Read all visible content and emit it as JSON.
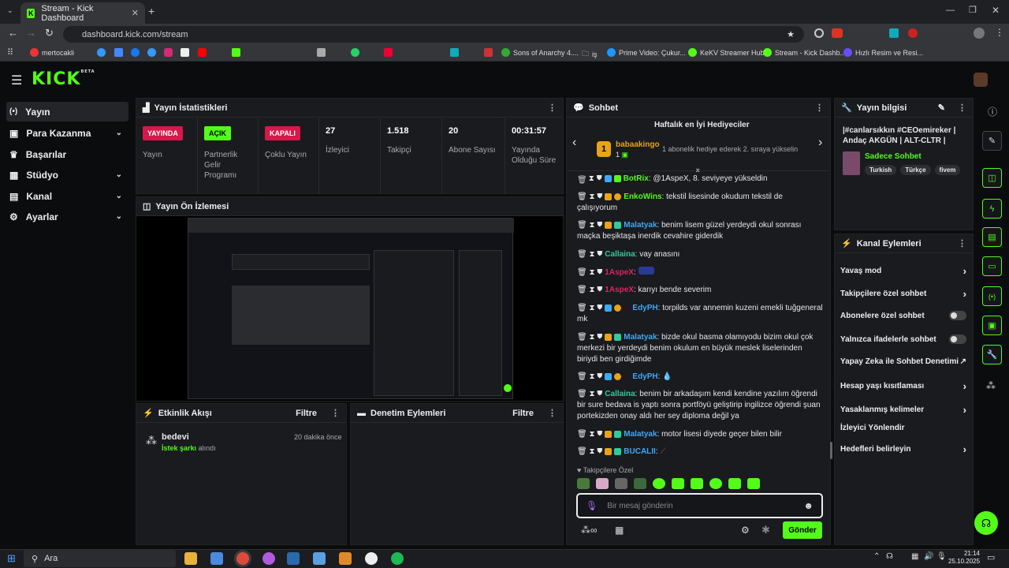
{
  "browser": {
    "tab_title": "Stream - Kick Dashboard",
    "url": "dashboard.kick.com/stream",
    "bookmarks": [
      "mertocakli",
      "Sons of Anarchy 4....",
      "iş",
      "Prime Video: Çukur...",
      "KeKV Streamer Hub",
      "Stream - Kick Dashb...",
      "Hızlı Resim ve Resi..."
    ]
  },
  "header": {
    "logo": "KICK",
    "beta": "BETA"
  },
  "sidebar": {
    "items": [
      {
        "label": "Yayın"
      },
      {
        "label": "Para Kazanma"
      },
      {
        "label": "Başarılar"
      },
      {
        "label": "Stüdyo"
      },
      {
        "label": "Kanal"
      },
      {
        "label": "Ayarlar"
      }
    ]
  },
  "stats": {
    "title": "Yayın İstatistikleri",
    "items": [
      {
        "value": "YAYINDA",
        "label": "Yayın",
        "color": "#d8184a"
      },
      {
        "value": "AÇIK",
        "label": "Partnerlik Gelir Programı",
        "color": "#53fc18"
      },
      {
        "value": "KAPALI",
        "label": "Çoklu Yayın",
        "color": "#d8184a"
      },
      {
        "value": "27",
        "label": "İzleyici"
      },
      {
        "value": "1.518",
        "label": "Takipçi"
      },
      {
        "value": "20",
        "label": "Abone Sayısı"
      },
      {
        "value": "00:31:57",
        "label": "Yayında Olduğu Süre"
      }
    ]
  },
  "preview": {
    "title": "Yayın Ön İzlemesi"
  },
  "activity": {
    "title": "Etkinlik Akışı",
    "filter": "Filtre",
    "item": {
      "user": "bedevi",
      "action": "İstek şarkı",
      "suffix": "alındı",
      "time": "20 dakika önce"
    }
  },
  "moderation": {
    "title": "Denetim Eylemleri",
    "filter": "Filtre"
  },
  "chat": {
    "title": "Sohbet",
    "gifters_title": "Haftalık en İyi Hediyeciler",
    "gifter_name": "babaakingo",
    "gifter_count": "1",
    "gifter_rank": "1",
    "gifter_note": "1 abonelik hediye ederek 2. sıraya yükselin",
    "messages": [
      {
        "user": "BotRix",
        "color": "#53fc18",
        "text": ": @1AspeX, 8. seviyeye yükseldin"
      },
      {
        "user": "EnkoWins",
        "color": "#53fc18",
        "text": ": tekstil lisesinde okudum tekstil de çalışıyorum"
      },
      {
        "user": "Malatyak",
        "color": "#3fa9f5",
        "text": ": benim lisem güzel yerdeydi okul sonrası maçka beşiktaşa inerdik cevahire giderdik"
      },
      {
        "user": "Callaina",
        "color": "#2ecc9a",
        "text": ": vay anasını"
      },
      {
        "user": "1AspeX",
        "color": "#e0245e",
        "text": ":"
      },
      {
        "user": "1AspeX",
        "color": "#e0245e",
        "text": ": karıyı bende severim"
      },
      {
        "user": "EdyPH",
        "color": "#3fa9f5",
        "text": ": torpilds var annemin kuzeni emekli tuğgeneral mk"
      },
      {
        "user": "Malatyak",
        "color": "#3fa9f5",
        "text": ": bizde okul basma olamıyodu bizim okul çok merkezi bir yerdeydi benim okulum en büyük meslek liselerinden biriydi ben girdiğimde"
      },
      {
        "user": "EdyPH",
        "color": "#3fa9f5",
        "text": ":"
      },
      {
        "user": "Callaina",
        "color": "#2ecc9a",
        "text": ": benim bir arkadaşım kendi kendine yazılım öğrendi bir sure bedava is yaptı sonra portföyü geliştirip ingilizce öğrendi şuan portekizden onay aldı her sey diploma değil ya"
      },
      {
        "user": "Malatyak",
        "color": "#3fa9f5",
        "text": ": motor lisesi diyede geçer bilen bilir"
      },
      {
        "user": "BUCALII",
        "color": "#3fa9f5",
        "text": ":"
      }
    ],
    "followers_only": "Takipçilere Özel",
    "placeholder": "Bir mesaj gönderin",
    "send": "Gönder"
  },
  "info": {
    "title": "Yayın bilgisi",
    "stream_title": "|#canlarsıkkın #CEOemireker | Andaç AKGÜN | ALT-CLTR | KEK...",
    "chat_mode": "Sadece Sohbet",
    "tags": [
      "Turkish",
      "Türkçe",
      "fivem"
    ]
  },
  "channel_actions": {
    "title": "Kanal Eylemleri",
    "items": [
      {
        "label": "Yavaş mod",
        "type": "chev"
      },
      {
        "label": "Takipçilere özel sohbet",
        "type": "chev"
      },
      {
        "label": "Abonelere özel sohbet",
        "type": "toggle"
      },
      {
        "label": "Yalnızca ifadelerle sohbet",
        "type": "toggle"
      },
      {
        "label": "Yapay Zeka ile Sohbet Denetimi",
        "type": "link"
      },
      {
        "label": "Hesap yaşı kısıtlaması",
        "type": "chev"
      },
      {
        "label": "Yasaklanmış kelimeler",
        "type": "chev"
      },
      {
        "label": "İzleyici Yönlendir",
        "type": "none"
      },
      {
        "label": "Hedefleri belirleyin",
        "type": "chev"
      }
    ]
  },
  "taskbar": {
    "search": "Ara",
    "time": "21:14",
    "date": "25.10.2025"
  }
}
